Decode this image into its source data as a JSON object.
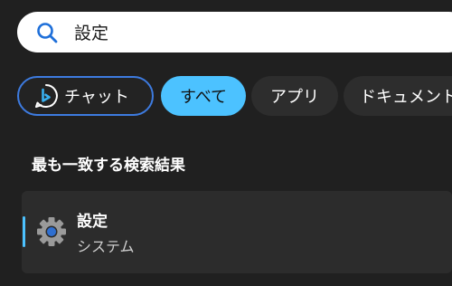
{
  "search": {
    "value": "設定",
    "icon": "search-icon"
  },
  "filters": {
    "chat_label": "チャット",
    "all_label": "すべて",
    "apps_label": "アプリ",
    "documents_label": "ドキュメント"
  },
  "section": {
    "title": "最も一致する検索結果"
  },
  "best_match": {
    "title": "設定",
    "subtitle": "システム",
    "icon": "gear-icon"
  },
  "colors": {
    "accent": "#4cc2ff",
    "chat_border": "#3d7be0",
    "background": "#202020"
  }
}
